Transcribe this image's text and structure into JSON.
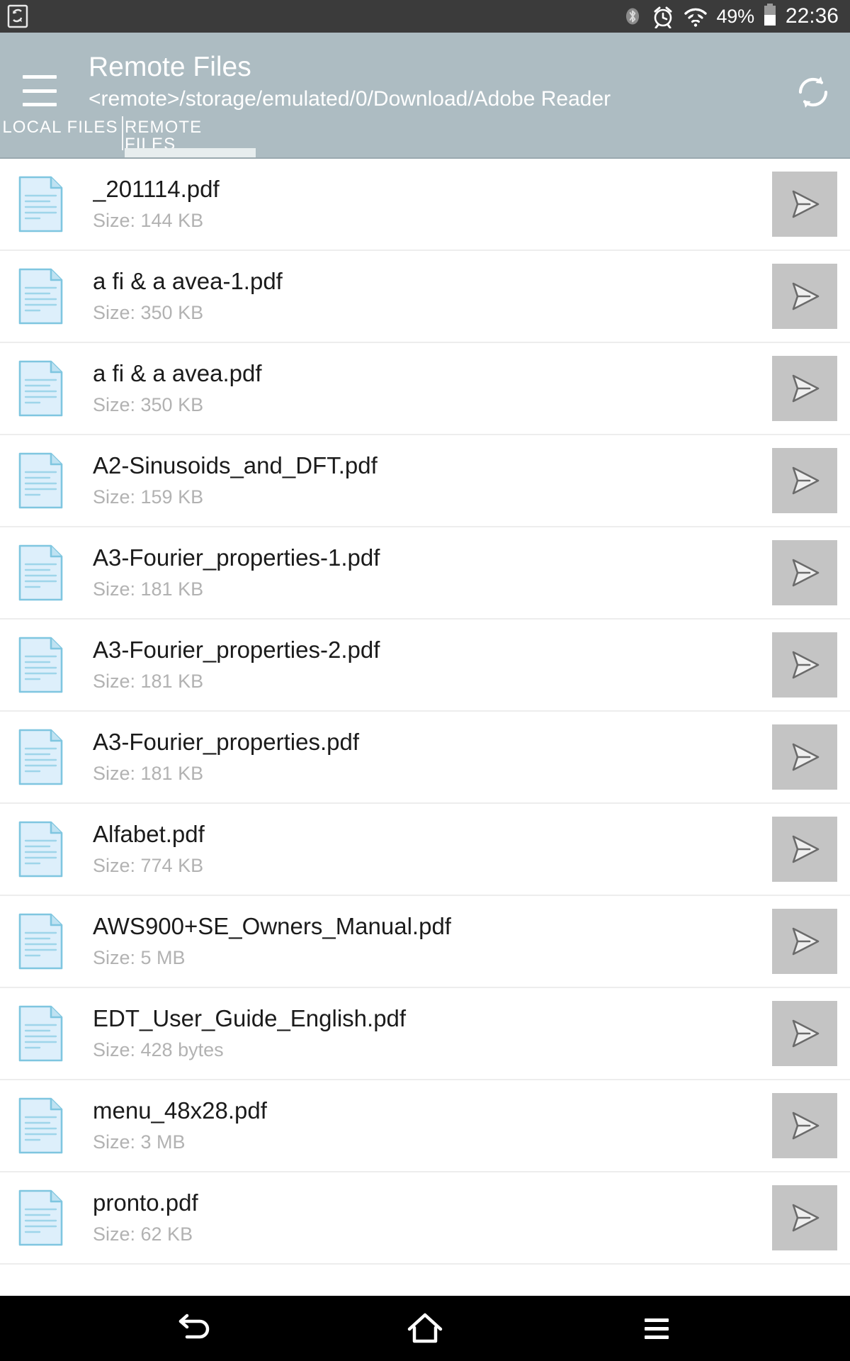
{
  "status_bar": {
    "sync_icon": "sync-phone-icon",
    "bluetooth_icon": "bluetooth-icon",
    "alarm_icon": "alarm-clock-icon",
    "wifi_icon": "wifi-icon",
    "battery_percent": "49%",
    "battery_icon": "battery-icon",
    "time": "22:36",
    "background_color": "#3b3b3b"
  },
  "app_bar": {
    "menu_icon": "hamburger-menu-icon",
    "title": "Remote Files",
    "subtitle": "<remote>/storage/emulated/0/Download/Adobe Reader",
    "refresh_icon": "refresh-icon",
    "background_color": "#adbcc2"
  },
  "tabs": {
    "items": [
      {
        "label": "LOCAL FILES",
        "active": false
      },
      {
        "label": "REMOTE FILES",
        "active": true
      }
    ],
    "active_index": 1,
    "indicator_color": "#e7edee"
  },
  "file_list": {
    "icon_name": "pdf-document-icon",
    "action_icon": "send-icon",
    "rows": [
      {
        "name": "_201114.pdf",
        "size": "Size: 144 KB"
      },
      {
        "name": "a fi & a avea-1.pdf",
        "size": "Size: 350 KB"
      },
      {
        "name": "a fi & a avea.pdf",
        "size": "Size: 350 KB"
      },
      {
        "name": "A2-Sinusoids_and_DFT.pdf",
        "size": "Size: 159 KB"
      },
      {
        "name": "A3-Fourier_properties-1.pdf",
        "size": "Size: 181 KB"
      },
      {
        "name": "A3-Fourier_properties-2.pdf",
        "size": "Size: 181 KB"
      },
      {
        "name": "A3-Fourier_properties.pdf",
        "size": "Size: 181 KB"
      },
      {
        "name": "Alfabet.pdf",
        "size": "Size: 774 KB"
      },
      {
        "name": "AWS900+SE_Owners_Manual.pdf",
        "size": "Size: 5 MB"
      },
      {
        "name": "EDT_User_Guide_English.pdf",
        "size": "Size: 428 bytes"
      },
      {
        "name": "menu_48x28.pdf",
        "size": "Size: 3 MB"
      },
      {
        "name": "pronto.pdf",
        "size": "Size: 62 KB"
      }
    ]
  },
  "nav_bar": {
    "back_icon": "back-icon",
    "home_icon": "home-icon",
    "recents_icon": "menu-icon",
    "background_color": "#000000"
  }
}
